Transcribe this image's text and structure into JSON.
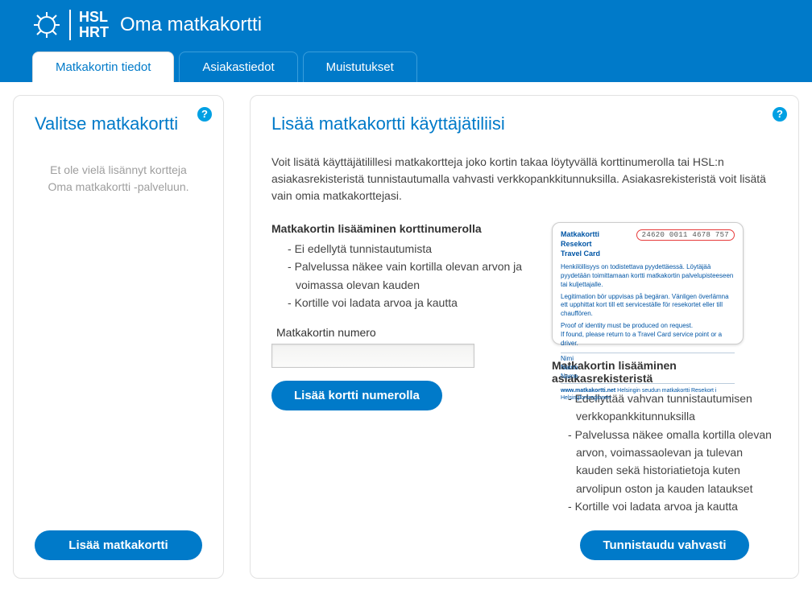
{
  "brand": {
    "hsl": "HSL",
    "hrt": "HRT",
    "app_name": "Oma matkakortti"
  },
  "tabs": [
    {
      "label": "Matkakortin tiedot",
      "active": true
    },
    {
      "label": "Asiakastiedot",
      "active": false
    },
    {
      "label": "Muistutukset",
      "active": false
    }
  ],
  "left": {
    "title": "Valitse matkakortti",
    "empty_message": "Et ole vielä lisännyt kortteja Oma matkakortti -palveluun.",
    "add_button": "Lisää matkakortti"
  },
  "right": {
    "title": "Lisää matkakortti käyttäjätiliisi",
    "intro": "Voit lisätä käyttäjätilillesi matkakortteja joko kortin takaa löytyvällä korttinumerolla tai HSL:n asiakasrekisteristä tunnistautumalla vahvasti verkkopankkitunnuksilla. Asiakasrekisteristä voit lisätä vain omia matkakorttejasi.",
    "by_number": {
      "heading": "Matkakortin lisääminen korttinumerolla",
      "bullets": [
        "Ei edellytä tunnistautumista",
        "Palvelussa näkee vain kortilla olevan arvon ja voimassa olevan kauden",
        "Kortille voi ladata arvoa ja kautta"
      ],
      "field_label": "Matkakortin numero",
      "field_value": "",
      "submit": "Lisää kortti numerolla"
    },
    "card_image": {
      "title_fi": "Matkakortti",
      "title_sv": "Resekort",
      "title_en": "Travel Card",
      "number": "24620 0011 4678 757",
      "text_fi": "Henkilöllisyys on todistettava pyydettäessä. Löytäjää pyydetään toimittamaan kortti matkakortin palvelupisteeseen tai kuljettajalle.",
      "text_sv": "Legitimation bör uppvisas på begäran. Vänligen överlämna ett upphittat kort till ett serviceställe för resekortet eller till chauffören.",
      "text_en": "Proof of identity must be produced on request.\nIf found, please return to a Travel Card service point or a driver.",
      "nimi": "Nimi",
      "namn": "Namn",
      "name": "Name",
      "footer_site": "www.matkakortti.net",
      "footer_rest": "Helsingin seudun matkakortti  Resekort i Helsingforsregionen"
    },
    "by_register": {
      "heading": "Matkakortin lisääminen asiakasrekisteristä",
      "bullets": [
        "Edellyttää vahvan tunnistautumisen verkkopankkitunnuksilla",
        "Palvelussa näkee omalla kortilla olevan arvon, voimassaolevan ja tulevan kauden sekä historiatietoja kuten arvolipun oston ja kauden lataukset",
        "Kortille voi ladata arvoa ja kautta"
      ],
      "submit": "Tunnistaudu vahvasti"
    }
  }
}
